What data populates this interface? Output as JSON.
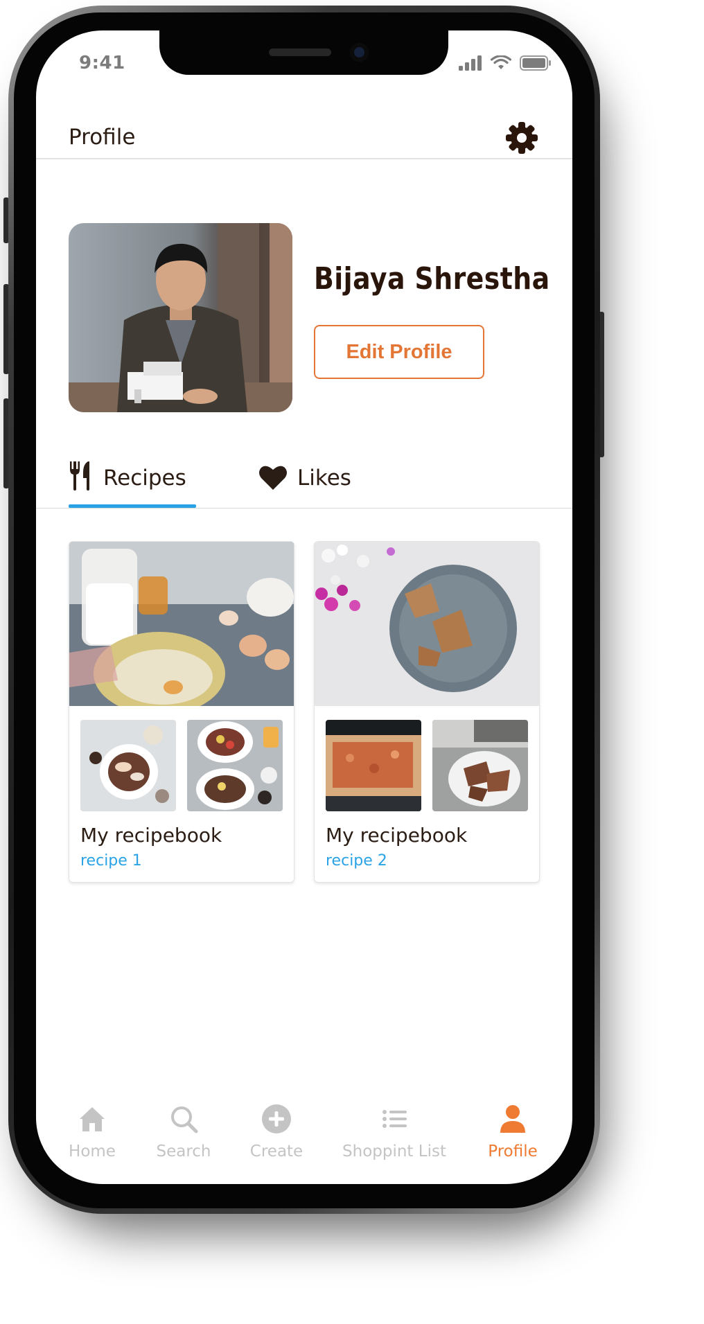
{
  "status_bar": {
    "time": "9:41"
  },
  "header": {
    "title": "Profile"
  },
  "profile": {
    "name": "Bijaya Shrestha",
    "edit_label": "Edit Profile"
  },
  "tabs": [
    {
      "label": "Recipes",
      "icon": "fork-knife-icon",
      "active": true
    },
    {
      "label": "Likes",
      "icon": "heart-icon",
      "active": false
    }
  ],
  "recipe_cards": [
    {
      "title": "My recipebook",
      "subtitle": "recipe 1"
    },
    {
      "title": "My recipebook",
      "subtitle": "recipe 2"
    }
  ],
  "bottom_nav": [
    {
      "label": "Home",
      "icon": "home-icon",
      "active": false
    },
    {
      "label": "Search",
      "icon": "search-icon",
      "active": false
    },
    {
      "label": "Create",
      "icon": "plus-circle-icon",
      "active": false
    },
    {
      "label": "Shoppint List",
      "icon": "list-icon",
      "active": false
    },
    {
      "label": "Profile",
      "icon": "person-icon",
      "active": true
    }
  ],
  "colors": {
    "accent": "#ef7a32",
    "edit_button": "#e37535",
    "link_blue": "#2aa3e6",
    "inactive_nav": "#c4c4c4",
    "text_dark": "#2b1c14"
  }
}
